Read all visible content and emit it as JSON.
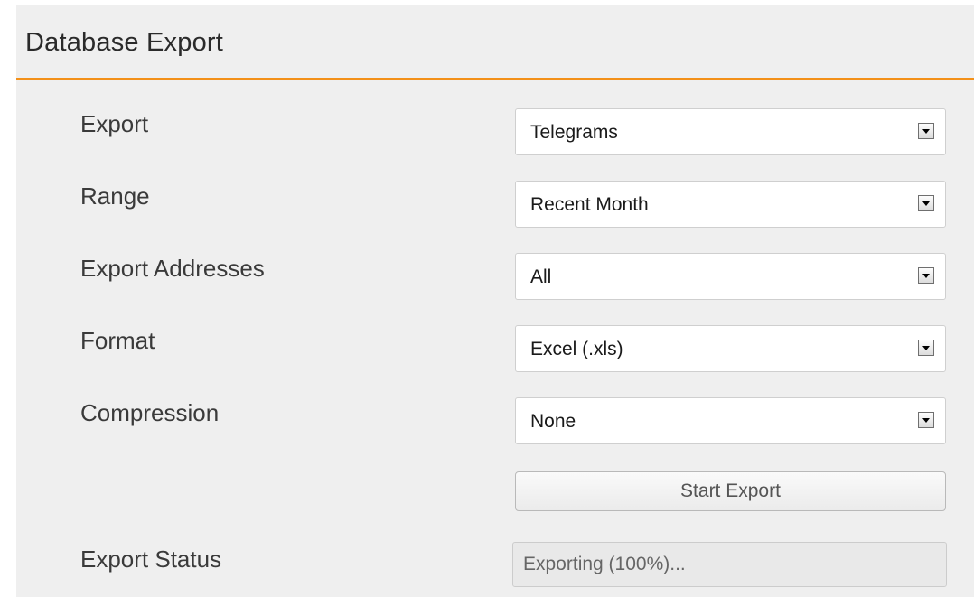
{
  "panel": {
    "title": "Database Export",
    "accent_color": "#f39019"
  },
  "rows": [
    {
      "label": "Export",
      "value": "Telegrams"
    },
    {
      "label": "Range",
      "value": "Recent Month"
    },
    {
      "label": "Export Addresses",
      "value": "All"
    },
    {
      "label": "Format",
      "value": "Excel (.xls)"
    },
    {
      "label": "Compression",
      "value": "None"
    }
  ],
  "actions": {
    "start_label": "Start Export"
  },
  "status": {
    "label": "Export Status",
    "value": "Exporting (100%)..."
  }
}
